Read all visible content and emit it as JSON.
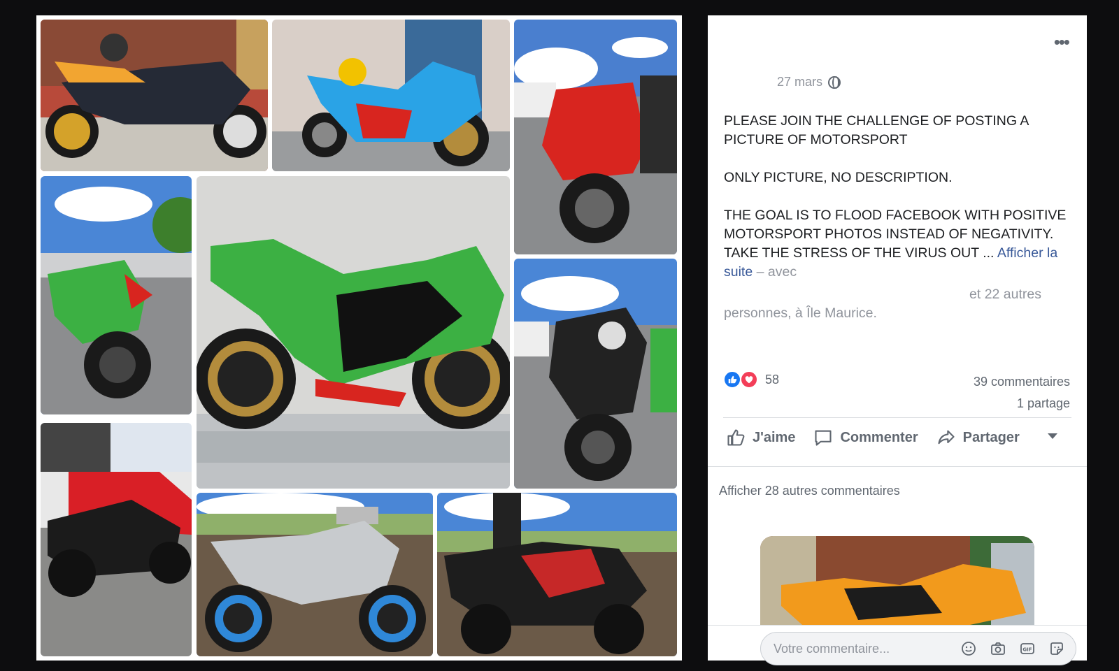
{
  "post": {
    "date": "27 mars",
    "privacy_icon": "globe-icon",
    "text_paragraphs": [
      "PLEASE JOIN THE CHALLENGE OF POSTING A PICTURE OF MOTORSPORT",
      "ONLY PICTURE, NO DESCRIPTION."
    ],
    "text_last": "THE GOAL IS TO FLOOD FACEBOOK WITH POSITIVE MOTORSPORT PHOTOS INSTEAD OF NEGATIVITY. TAKE THE STRESS OF THE VIRUS OUT ...",
    "see_more": "Afficher la suite",
    "with_label": "– avec",
    "others_count": "et 22 autres",
    "people_location": "personnes, à Île Maurice."
  },
  "stats": {
    "reaction_count": "58",
    "comments": "39 commentaires",
    "shares": "1 partage"
  },
  "actions": {
    "like": "J'aime",
    "comment": "Commenter",
    "share": "Partager"
  },
  "comments": {
    "more": "Afficher 28 autres commentaires",
    "placeholder": "Votre commentaire..."
  },
  "photos": [
    {
      "subject": "black-gold-motorcycle",
      "color": "#f2a531"
    },
    {
      "subject": "blue-motorcycle",
      "color": "#2aa3e6"
    },
    {
      "subject": "red-motorcycle",
      "color": "#d8251f"
    },
    {
      "subject": "green-motorcycle",
      "color": "#3cb043"
    },
    {
      "subject": "green-ninja-motorcycle",
      "color": "#3cb043"
    },
    {
      "subject": "black-naked-motorcycle",
      "color": "#222222"
    },
    {
      "subject": "black-motorcycle-red-car",
      "color": "#d91f26"
    },
    {
      "subject": "white-blue-motorcycle",
      "color": "#2f88d8"
    },
    {
      "subject": "red-black-kawasaki",
      "color": "#c62828"
    }
  ],
  "colors": {
    "link": "#385898",
    "like_blue": "#1877f2",
    "love_red": "#f33e58",
    "text_grey": "#606770"
  }
}
